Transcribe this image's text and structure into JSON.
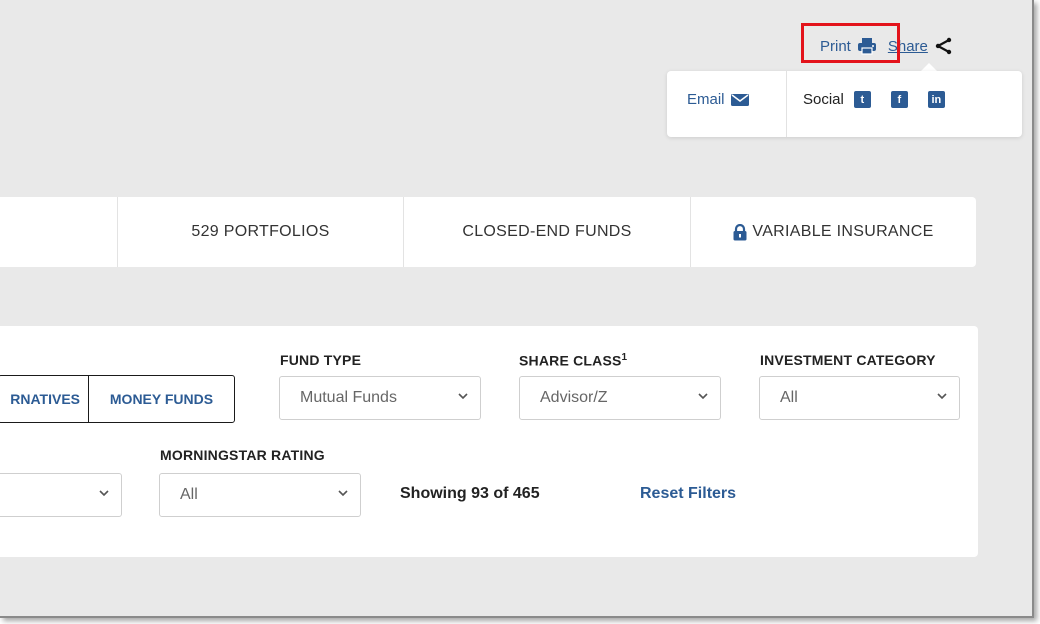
{
  "header": {
    "print_label": "Print",
    "share_label": "Share",
    "print_icon": "printer-icon",
    "share_icon": "share-icon"
  },
  "share_popover": {
    "email_label": "Email",
    "social_label": "Social",
    "email_icon": "envelope-icon",
    "social_icons": [
      "twitter-icon",
      "facebook-icon",
      "linkedin-icon"
    ]
  },
  "tabs": [
    {
      "label": "529 PORTFOLIOS"
    },
    {
      "label": "CLOSED-END FUNDS"
    },
    {
      "label": "VARIABLE INSURANCE",
      "icon": "lock-icon"
    }
  ],
  "filters": {
    "asset_segments": [
      "RNATIVES",
      "MONEY FUNDS"
    ],
    "fund_type": {
      "label": "FUND TYPE",
      "value": "Mutual Funds"
    },
    "share_class": {
      "label": "SHARE CLASS",
      "footnote": "1",
      "value": "Advisor/Z"
    },
    "investment_category": {
      "label": "INVESTMENT CATEGORY",
      "value": "All"
    },
    "morningstar_rating": {
      "label": "MORNINGSTAR RATING",
      "value": "All"
    },
    "showing_text": "Showing 93 of 465",
    "reset_label": "Reset Filters"
  },
  "colors": {
    "accent": "#2c5b94",
    "highlight": "#e3131b",
    "background": "#e9e9e9"
  }
}
